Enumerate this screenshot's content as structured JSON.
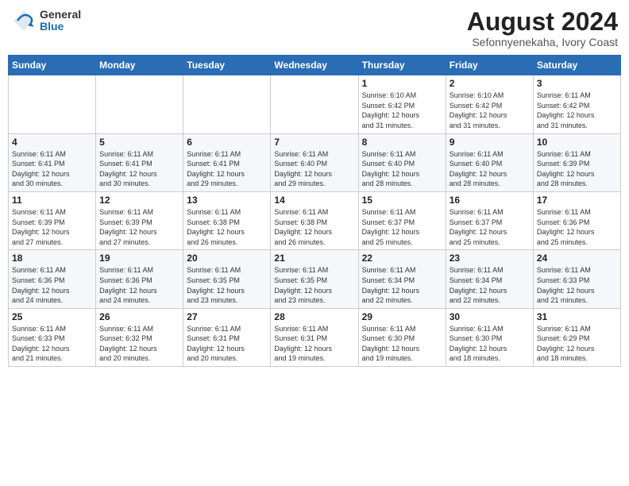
{
  "logo": {
    "general": "General",
    "blue": "Blue"
  },
  "title": "August 2024",
  "location": "Sefonnyenekaha, Ivory Coast",
  "weekdays": [
    "Sunday",
    "Monday",
    "Tuesday",
    "Wednesday",
    "Thursday",
    "Friday",
    "Saturday"
  ],
  "weeks": [
    [
      {
        "day": "",
        "info": ""
      },
      {
        "day": "",
        "info": ""
      },
      {
        "day": "",
        "info": ""
      },
      {
        "day": "",
        "info": ""
      },
      {
        "day": "1",
        "info": "Sunrise: 6:10 AM\nSunset: 6:42 PM\nDaylight: 12 hours\nand 31 minutes."
      },
      {
        "day": "2",
        "info": "Sunrise: 6:10 AM\nSunset: 6:42 PM\nDaylight: 12 hours\nand 31 minutes."
      },
      {
        "day": "3",
        "info": "Sunrise: 6:11 AM\nSunset: 6:42 PM\nDaylight: 12 hours\nand 31 minutes."
      }
    ],
    [
      {
        "day": "4",
        "info": "Sunrise: 6:11 AM\nSunset: 6:41 PM\nDaylight: 12 hours\nand 30 minutes."
      },
      {
        "day": "5",
        "info": "Sunrise: 6:11 AM\nSunset: 6:41 PM\nDaylight: 12 hours\nand 30 minutes."
      },
      {
        "day": "6",
        "info": "Sunrise: 6:11 AM\nSunset: 6:41 PM\nDaylight: 12 hours\nand 29 minutes."
      },
      {
        "day": "7",
        "info": "Sunrise: 6:11 AM\nSunset: 6:40 PM\nDaylight: 12 hours\nand 29 minutes."
      },
      {
        "day": "8",
        "info": "Sunrise: 6:11 AM\nSunset: 6:40 PM\nDaylight: 12 hours\nand 28 minutes."
      },
      {
        "day": "9",
        "info": "Sunrise: 6:11 AM\nSunset: 6:40 PM\nDaylight: 12 hours\nand 28 minutes."
      },
      {
        "day": "10",
        "info": "Sunrise: 6:11 AM\nSunset: 6:39 PM\nDaylight: 12 hours\nand 28 minutes."
      }
    ],
    [
      {
        "day": "11",
        "info": "Sunrise: 6:11 AM\nSunset: 6:39 PM\nDaylight: 12 hours\nand 27 minutes."
      },
      {
        "day": "12",
        "info": "Sunrise: 6:11 AM\nSunset: 6:39 PM\nDaylight: 12 hours\nand 27 minutes."
      },
      {
        "day": "13",
        "info": "Sunrise: 6:11 AM\nSunset: 6:38 PM\nDaylight: 12 hours\nand 26 minutes."
      },
      {
        "day": "14",
        "info": "Sunrise: 6:11 AM\nSunset: 6:38 PM\nDaylight: 12 hours\nand 26 minutes."
      },
      {
        "day": "15",
        "info": "Sunrise: 6:11 AM\nSunset: 6:37 PM\nDaylight: 12 hours\nand 25 minutes."
      },
      {
        "day": "16",
        "info": "Sunrise: 6:11 AM\nSunset: 6:37 PM\nDaylight: 12 hours\nand 25 minutes."
      },
      {
        "day": "17",
        "info": "Sunrise: 6:11 AM\nSunset: 6:36 PM\nDaylight: 12 hours\nand 25 minutes."
      }
    ],
    [
      {
        "day": "18",
        "info": "Sunrise: 6:11 AM\nSunset: 6:36 PM\nDaylight: 12 hours\nand 24 minutes."
      },
      {
        "day": "19",
        "info": "Sunrise: 6:11 AM\nSunset: 6:36 PM\nDaylight: 12 hours\nand 24 minutes."
      },
      {
        "day": "20",
        "info": "Sunrise: 6:11 AM\nSunset: 6:35 PM\nDaylight: 12 hours\nand 23 minutes."
      },
      {
        "day": "21",
        "info": "Sunrise: 6:11 AM\nSunset: 6:35 PM\nDaylight: 12 hours\nand 23 minutes."
      },
      {
        "day": "22",
        "info": "Sunrise: 6:11 AM\nSunset: 6:34 PM\nDaylight: 12 hours\nand 22 minutes."
      },
      {
        "day": "23",
        "info": "Sunrise: 6:11 AM\nSunset: 6:34 PM\nDaylight: 12 hours\nand 22 minutes."
      },
      {
        "day": "24",
        "info": "Sunrise: 6:11 AM\nSunset: 6:33 PM\nDaylight: 12 hours\nand 21 minutes."
      }
    ],
    [
      {
        "day": "25",
        "info": "Sunrise: 6:11 AM\nSunset: 6:33 PM\nDaylight: 12 hours\nand 21 minutes."
      },
      {
        "day": "26",
        "info": "Sunrise: 6:11 AM\nSunset: 6:32 PM\nDaylight: 12 hours\nand 20 minutes."
      },
      {
        "day": "27",
        "info": "Sunrise: 6:11 AM\nSunset: 6:31 PM\nDaylight: 12 hours\nand 20 minutes."
      },
      {
        "day": "28",
        "info": "Sunrise: 6:11 AM\nSunset: 6:31 PM\nDaylight: 12 hours\nand 19 minutes."
      },
      {
        "day": "29",
        "info": "Sunrise: 6:11 AM\nSunset: 6:30 PM\nDaylight: 12 hours\nand 19 minutes."
      },
      {
        "day": "30",
        "info": "Sunrise: 6:11 AM\nSunset: 6:30 PM\nDaylight: 12 hours\nand 18 minutes."
      },
      {
        "day": "31",
        "info": "Sunrise: 6:11 AM\nSunset: 6:29 PM\nDaylight: 12 hours\nand 18 minutes."
      }
    ]
  ]
}
